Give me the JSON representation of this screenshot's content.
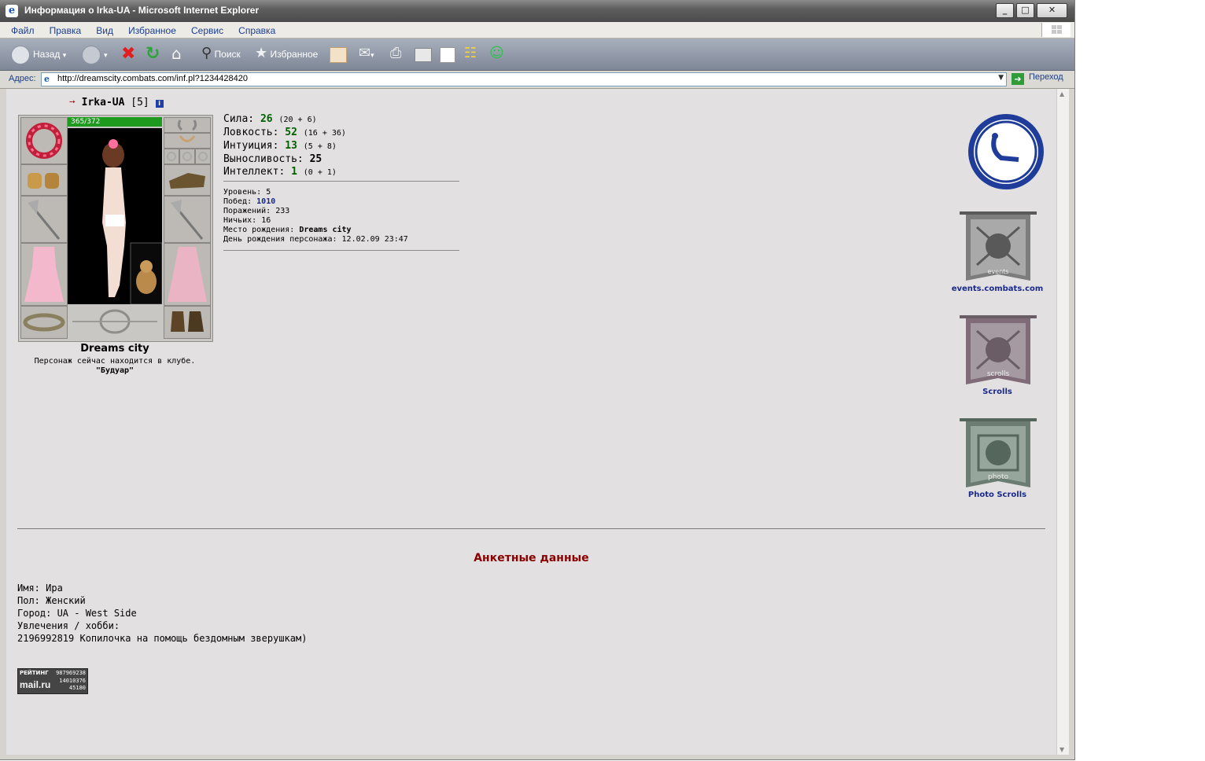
{
  "window": {
    "title": "Информация о Irka-UA - Microsoft Internet Explorer",
    "minimize": "_",
    "maximize": "□",
    "close": "✕"
  },
  "menu": [
    "Файл",
    "Правка",
    "Вид",
    "Избранное",
    "Сервис",
    "Справка"
  ],
  "toolbar": {
    "back": "Назад",
    "search": "Поиск",
    "favorites": "Избранное"
  },
  "address": {
    "label": "Адрес:",
    "url": "http://dreamscity.combats.com/inf.pl?1234428420",
    "go": "Переход"
  },
  "character": {
    "name": "Irka-UA",
    "level": "[5]",
    "hp": "365/372",
    "city": "Dreams city",
    "club_text": "Персонаж сейчас находится в клубе.",
    "club_name": "\"Будуар\""
  },
  "stats": [
    {
      "label": "Сила:",
      "value": "26",
      "detail": "(20 + 6)"
    },
    {
      "label": "Ловкость:",
      "value": "52",
      "detail": "(16 + 36)"
    },
    {
      "label": "Интуиция:",
      "value": "13",
      "detail": "(5 + 8)"
    },
    {
      "label": "Выносливость:",
      "value": "25",
      "detail": ""
    },
    {
      "label": "Интеллект:",
      "value": "1",
      "detail": "(0 + 1)"
    }
  ],
  "info": {
    "level_label": "Уровень:",
    "level": "5",
    "wins_label": "Побед:",
    "wins": "1010",
    "losses_label": "Поражений:",
    "losses": "233",
    "draws_label": "Ничьих:",
    "draws": "16",
    "birthplace_label": "Место рождения:",
    "birthplace": "Dreams city",
    "birthday_label": "День рождения персонажа:",
    "birthday": "12.02.09 23:47"
  },
  "links": {
    "events": "events.combats.com",
    "events_badge": "events",
    "scrolls": "Scrolls",
    "scrolls_badge": "scrolls",
    "photo": "Photo Scrolls",
    "photo_badge": "photo"
  },
  "anketa": {
    "title": "Анкетные данные",
    "name": "Имя: Ира",
    "sex": "Пол: Женский",
    "city": "Город: UA - West Side",
    "hobby": "Увлечения / хобби:",
    "note": "2196992819 Копилочка на помощь бездомным зверушкам)"
  },
  "counter": {
    "label": "РЕЙТИНГ",
    "n1": "987969238",
    "n2": "14010376",
    "n3": "45180",
    "brand": "mail.ru"
  }
}
